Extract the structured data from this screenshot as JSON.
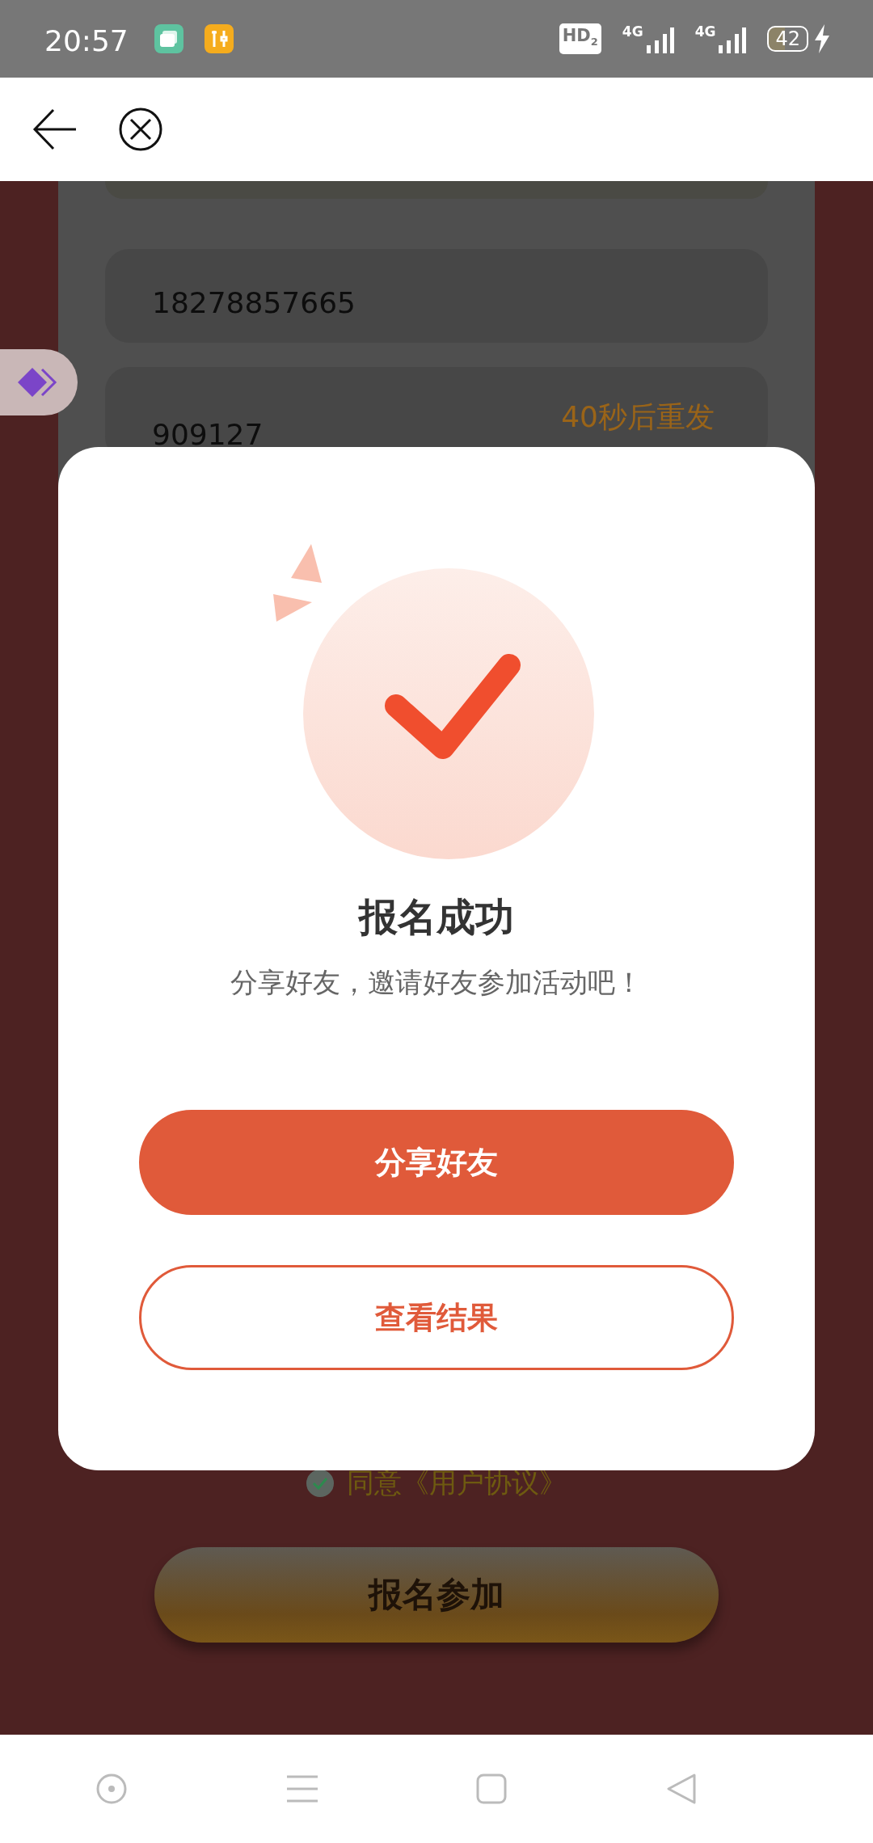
{
  "status_bar": {
    "time": "20:57",
    "hd": "HD$_{2}$",
    "networks": [
      "4G",
      "4G"
    ],
    "battery": "42",
    "charging": true
  },
  "form": {
    "phone": "18278857665",
    "code": "909127",
    "resend": "40秒后重发"
  },
  "agreement": {
    "checked": true,
    "text": "同意《用户协议》"
  },
  "submit": "报名参加",
  "dialog": {
    "title": "报名成功",
    "message": "分享好友，邀请好友参加活动吧！",
    "buttons": [
      {
        "label": "分享好友",
        "kind": "primary"
      },
      {
        "label": "查看结果",
        "kind": "outline"
      }
    ]
  }
}
